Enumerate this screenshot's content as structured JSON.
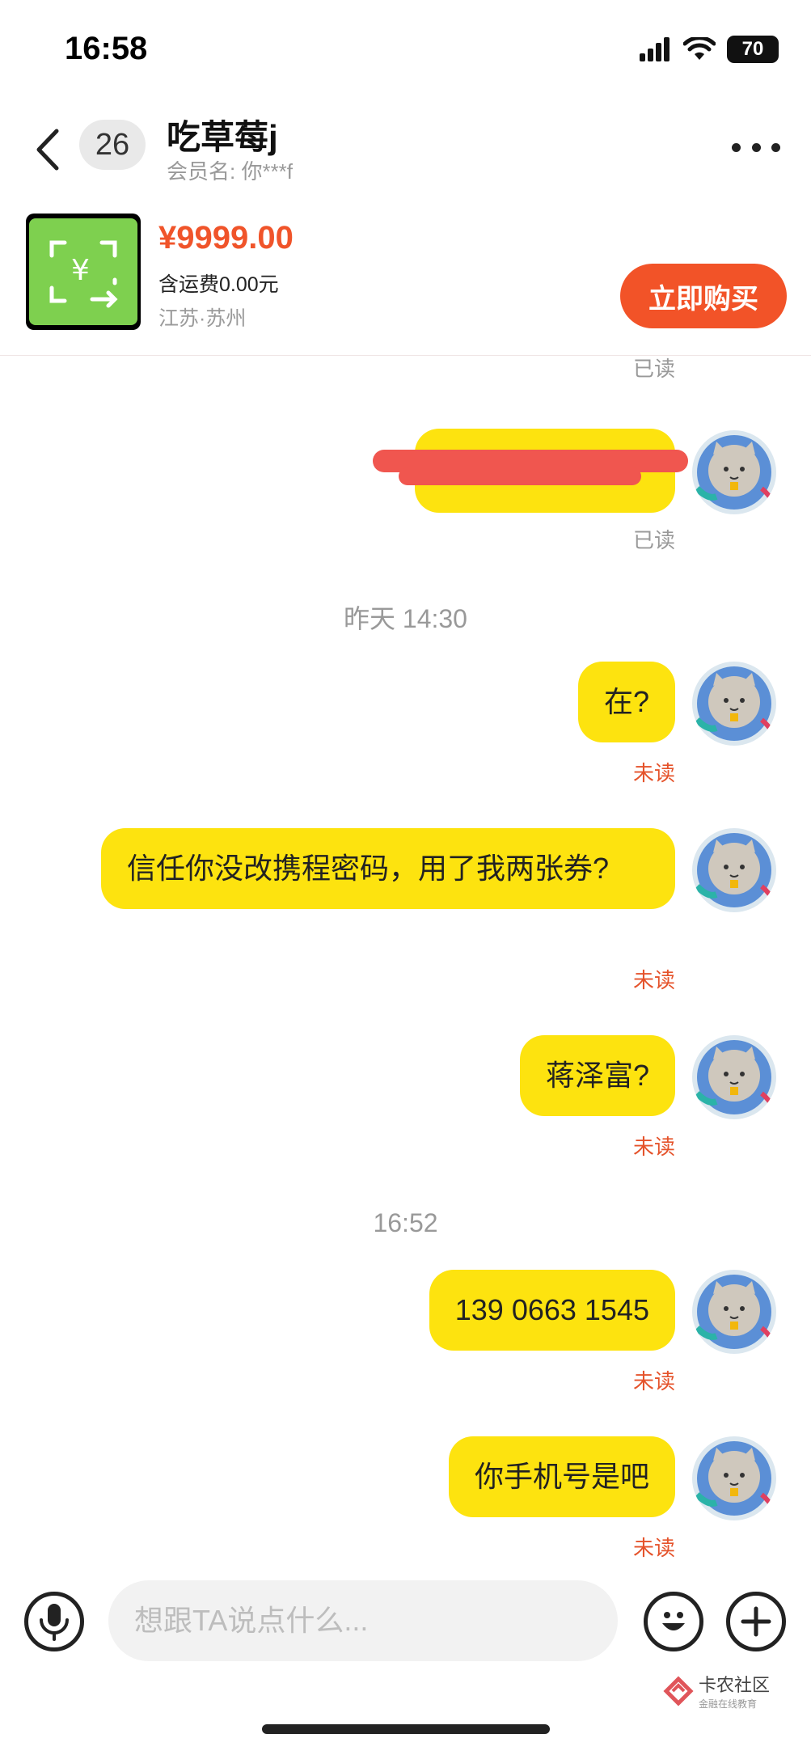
{
  "status_bar": {
    "time": "16:58",
    "battery": "70"
  },
  "header": {
    "unread_count": "26",
    "contact_name": "吃草莓j",
    "member_label": "会员名: 你***f"
  },
  "product": {
    "price": "¥9999.00",
    "shipping": "含运费0.00元",
    "location": "江苏·苏州",
    "buy_label": "立即购买",
    "thumb_color": "#7ed04f"
  },
  "chat": {
    "messages": [
      {
        "status": "已读"
      },
      {
        "text": "",
        "status": "已读",
        "redacted": true
      },
      {
        "time": "昨天 14:30"
      },
      {
        "text": "在?",
        "status": "未读"
      },
      {
        "text": "信任你没改携程密码，用了我两张券?",
        "status": "未读"
      },
      {
        "text": "蒋泽富?",
        "status": "未读"
      },
      {
        "time": "16:52"
      },
      {
        "text": "139 0663 1545",
        "status": "未读"
      },
      {
        "text": "你手机号是吧",
        "status": "未读"
      }
    ]
  },
  "input": {
    "placeholder": "想跟TA说点什么..."
  },
  "watermark": {
    "title": "卡农社区",
    "subtitle": "金融在线教育"
  },
  "colors": {
    "bubble": "#fde30f",
    "accent": "#f25328",
    "unread": "#e5532b"
  }
}
